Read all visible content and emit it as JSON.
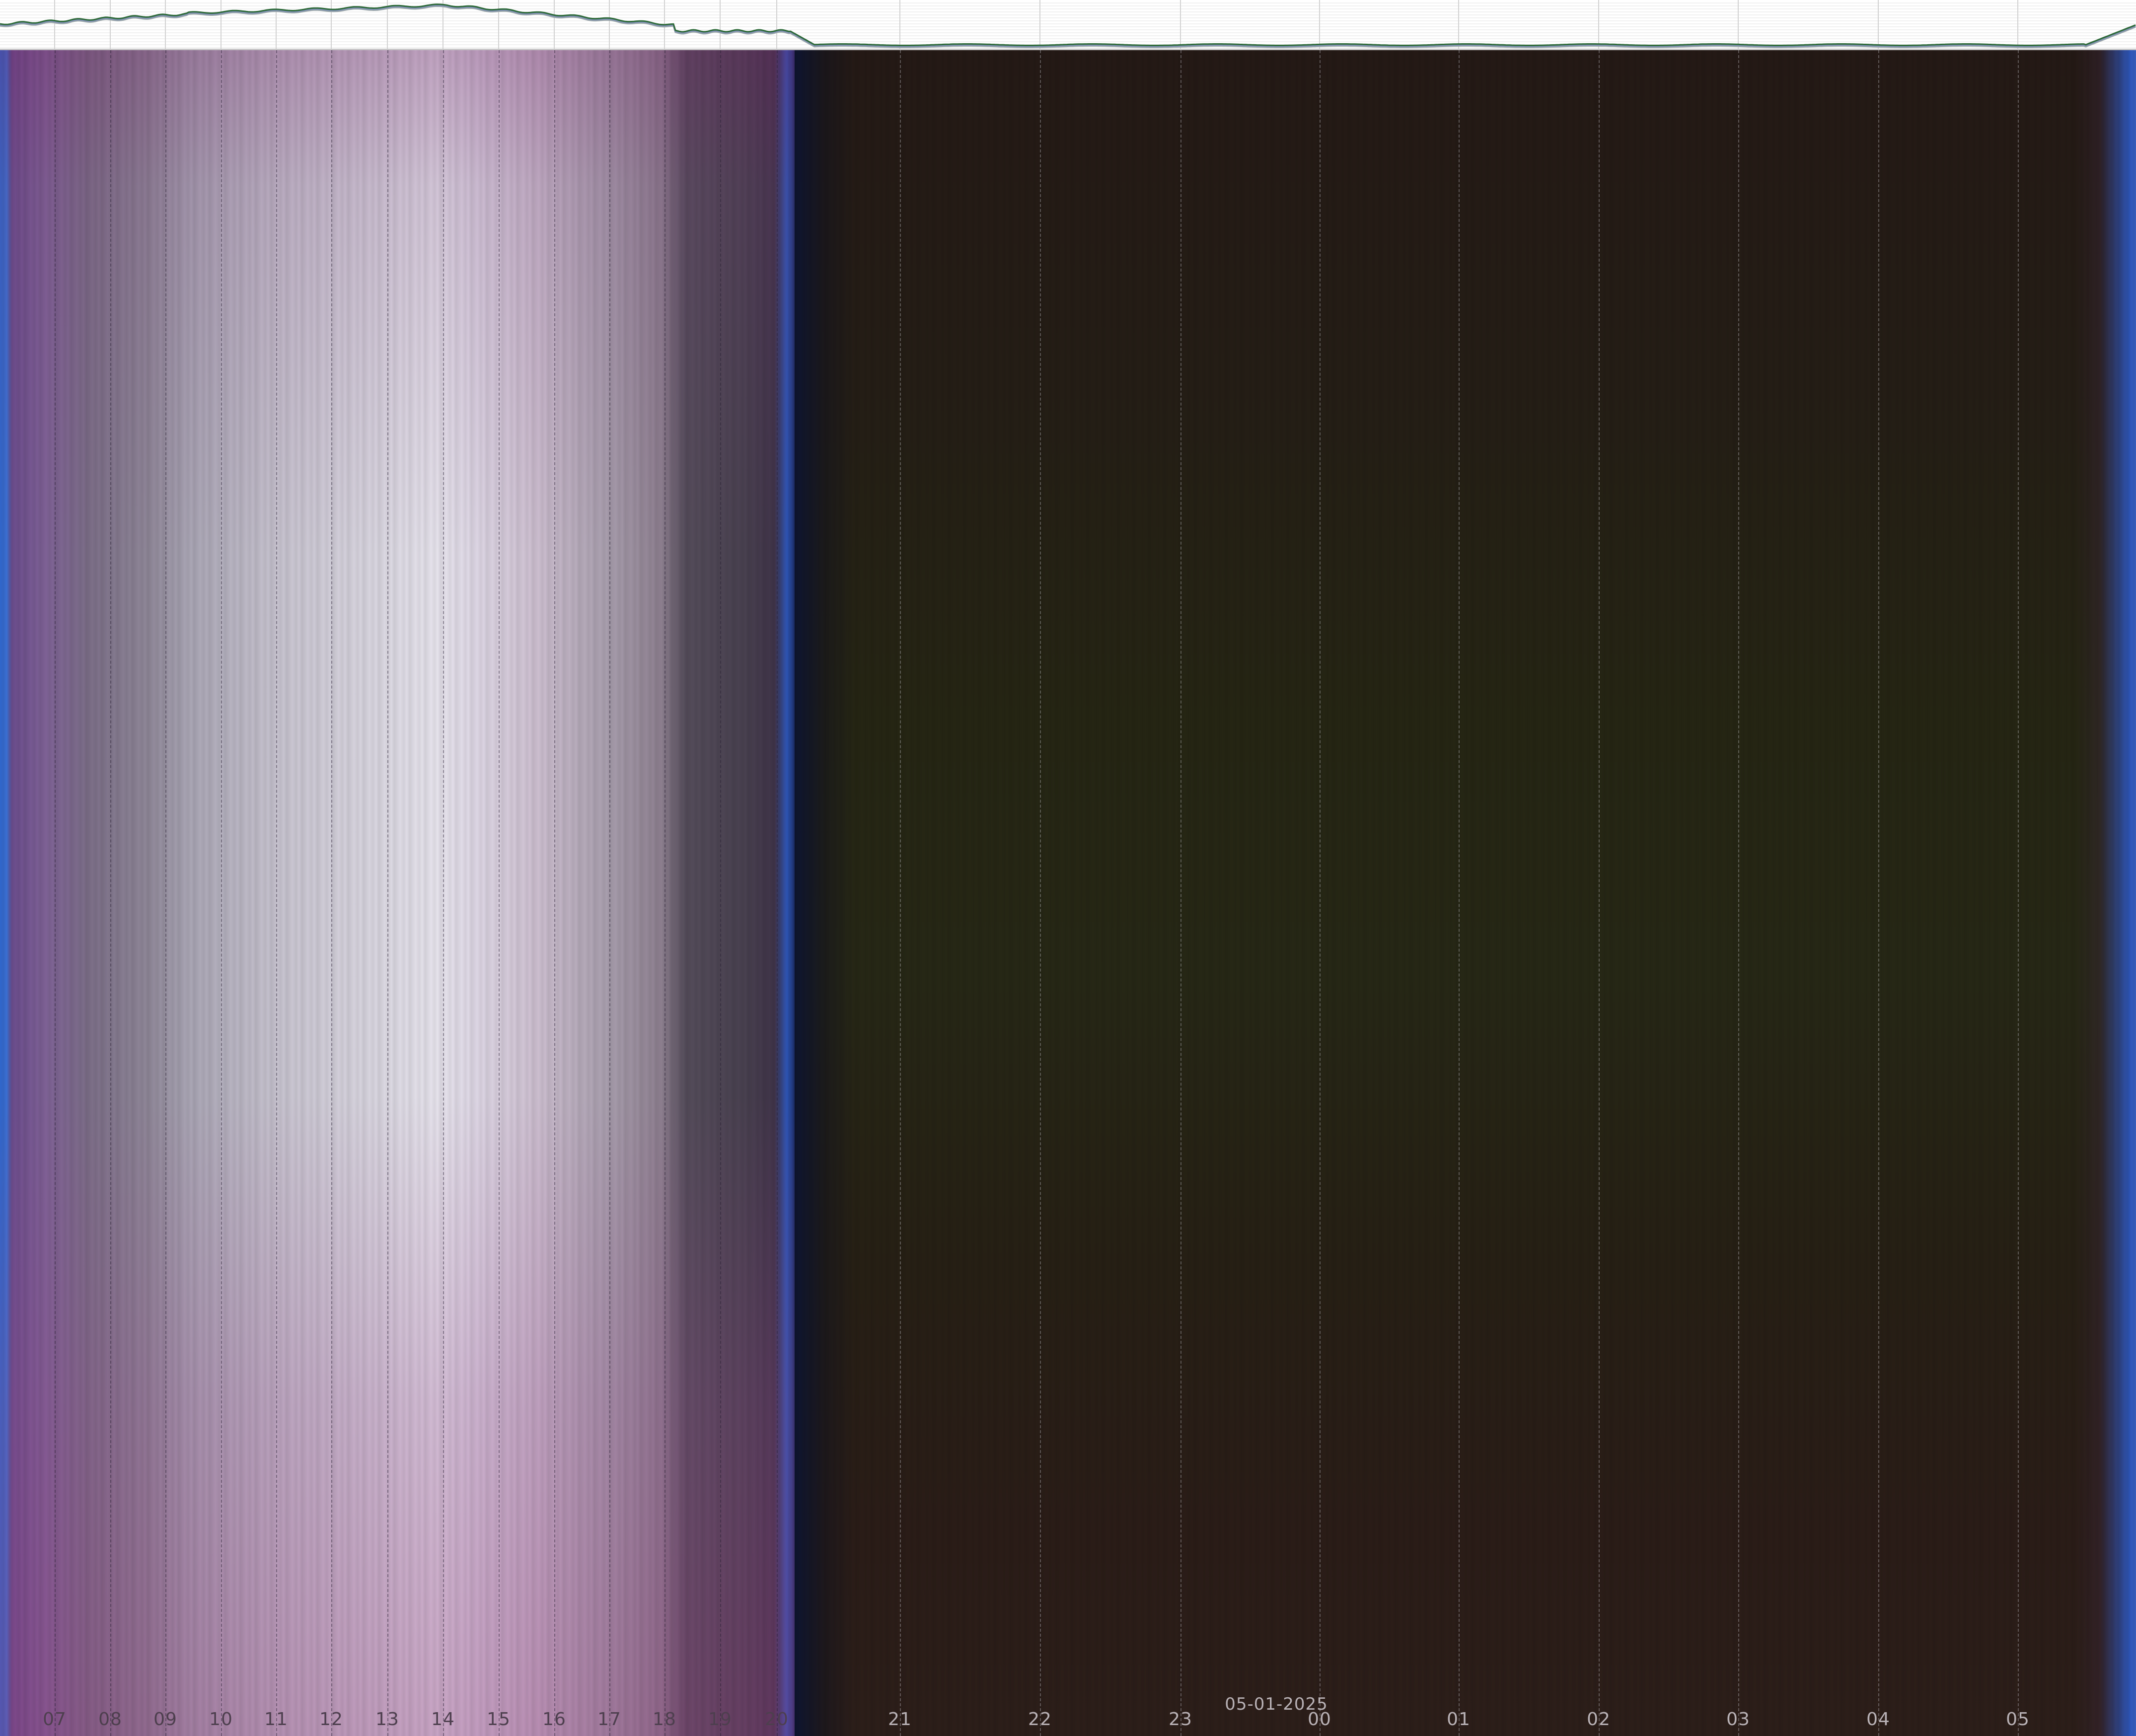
{
  "hour_labels": [
    "07",
    "08",
    "09",
    "10",
    "11",
    "12",
    "13",
    "14",
    "15",
    "16",
    "17",
    "18",
    "19",
    "20",
    "21",
    "22",
    "23",
    "00",
    "01",
    "02",
    "03",
    "04",
    "05"
  ],
  "date_label": "05-01-2025",
  "colors": {
    "graph_background": "#ffffff",
    "graph_line_primary": "#2f6b3a",
    "graph_line_secondary": "#9aa6a8",
    "graph_line_tertiary": "#7e8fb5",
    "day_sky": "#e6e3ec",
    "dusk_blue": "#2d55b8",
    "night_sky": "#252513"
  }
}
